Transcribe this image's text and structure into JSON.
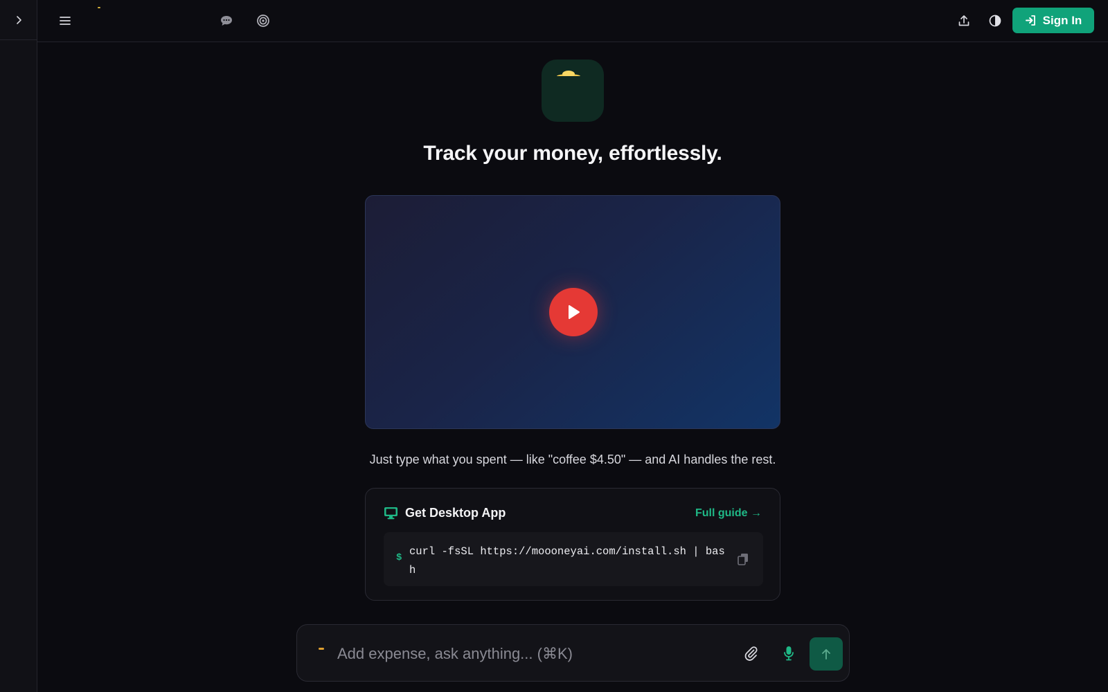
{
  "sidebar": {
    "expand_icon": "chevron-right-icon"
  },
  "topbar": {
    "menu_icon": "hamburger-icon",
    "chat_icon": "chat-bubble-icon",
    "goals_icon": "target-icon",
    "share_icon": "upload-icon",
    "theme_icon": "contrast-icon",
    "sign_in_label": "Sign In",
    "sign_in_icon": "sign-in-icon"
  },
  "hero": {
    "headline": "Track your money, effortlessly.",
    "tagline": "Just type what you spent — like \"coffee $4.50\" — and AI handles the rest."
  },
  "video": {
    "play_icon": "play-icon"
  },
  "desktop_app": {
    "title": "Get Desktop App",
    "guide_link": "Full guide →",
    "prompt": "$",
    "command": "curl -fsSL https://moooneyai.com/install.sh | bash",
    "copy_icon": "copy-icon"
  },
  "composer": {
    "placeholder": "Add expense, ask anything... (⌘K)",
    "attach_icon": "paperclip-icon",
    "mic_icon": "microphone-icon",
    "send_icon": "arrow-up-icon"
  },
  "colors": {
    "background": "#0b0b10",
    "accent": "#10a37a",
    "play": "#e53935",
    "link": "#1fb886"
  }
}
